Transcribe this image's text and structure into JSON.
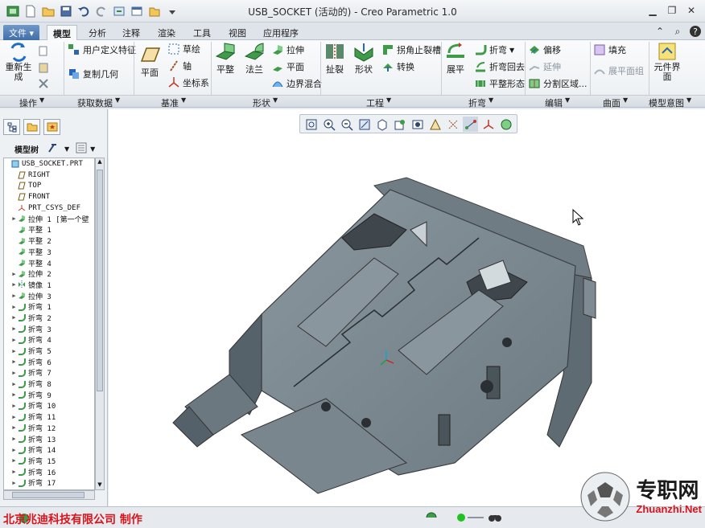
{
  "window": {
    "title": "USB_SOCKET (活动的) - Creo Parametric 1.0"
  },
  "tabs": [
    {
      "label": "文件"
    },
    {
      "label": "模型"
    },
    {
      "label": "分析"
    },
    {
      "label": "注释"
    },
    {
      "label": "渲染"
    },
    {
      "label": "工具"
    },
    {
      "label": "视图"
    },
    {
      "label": "应用程序"
    }
  ],
  "ribbon": {
    "regen": "重新生成",
    "user_feature": "用户定义特征",
    "copy_geom": "复制几何",
    "plane": "平面",
    "sketch": "草绘",
    "axis": "轴",
    "csys": "坐标系",
    "flat": "平整",
    "flange": "法兰",
    "extrude": "拉伸",
    "flat2": "平面",
    "blend": "边界混合",
    "rip": "扯裂",
    "shape": "形状",
    "corner_relief": "拐角止裂槽",
    "convert": "转换",
    "unbend": "展平",
    "bend": "折弯",
    "bend_back": "折弯回去",
    "flat_pattern": "平整形态",
    "offset": "偏移",
    "extend": "延伸",
    "split_area": "分割区域...",
    "fill": "填充",
    "unbend_group": "展平面组",
    "comp_interface": "元件界面"
  },
  "groups": [
    "操作",
    "获取数据",
    "基准",
    "形状",
    "工程",
    "折弯",
    "编辑",
    "曲面",
    "模型意图"
  ],
  "panel": {
    "tree_label": "模型树"
  },
  "tree": [
    {
      "label": "USB_SOCKET.PRT",
      "icon": "part",
      "expand": false,
      "indent": 0
    },
    {
      "label": "RIGHT",
      "icon": "datum-plane",
      "expand": false,
      "indent": 1
    },
    {
      "label": "TOP",
      "icon": "datum-plane",
      "expand": false,
      "indent": 1
    },
    {
      "label": "FRONT",
      "icon": "datum-plane",
      "expand": false,
      "indent": 1
    },
    {
      "label": "PRT_CSYS_DEF",
      "icon": "csys",
      "expand": false,
      "indent": 1
    },
    {
      "label": "拉伸 1 [第一个壁",
      "icon": "wall",
      "expand": true,
      "indent": 1
    },
    {
      "label": "平整 1",
      "icon": "wall",
      "expand": false,
      "indent": 1
    },
    {
      "label": "平整 2",
      "icon": "wall",
      "expand": false,
      "indent": 1
    },
    {
      "label": "平整 3",
      "icon": "wall",
      "expand": false,
      "indent": 1
    },
    {
      "label": "平整 4",
      "icon": "wall",
      "expand": false,
      "indent": 1
    },
    {
      "label": "拉伸 2",
      "icon": "cut",
      "expand": true,
      "indent": 1
    },
    {
      "label": "镜像 1",
      "icon": "mirror",
      "expand": true,
      "indent": 1
    },
    {
      "label": "拉伸 3",
      "icon": "cut",
      "expand": true,
      "indent": 1
    },
    {
      "label": "折弯 1",
      "icon": "bend",
      "expand": true,
      "indent": 1
    },
    {
      "label": "折弯 2",
      "icon": "bend",
      "expand": true,
      "indent": 1
    },
    {
      "label": "折弯 3",
      "icon": "bend",
      "expand": true,
      "indent": 1
    },
    {
      "label": "折弯 4",
      "icon": "bend",
      "expand": true,
      "indent": 1
    },
    {
      "label": "折弯 5",
      "icon": "bend",
      "expand": true,
      "indent": 1
    },
    {
      "label": "折弯 6",
      "icon": "bend",
      "expand": true,
      "indent": 1
    },
    {
      "label": "折弯 7",
      "icon": "bend",
      "expand": true,
      "indent": 1
    },
    {
      "label": "折弯 8",
      "icon": "bend",
      "expand": true,
      "indent": 1
    },
    {
      "label": "折弯 9",
      "icon": "bend",
      "expand": true,
      "indent": 1
    },
    {
      "label": "折弯 10",
      "icon": "bend",
      "expand": true,
      "indent": 1
    },
    {
      "label": "折弯 11",
      "icon": "bend",
      "expand": true,
      "indent": 1
    },
    {
      "label": "折弯 12",
      "icon": "bend",
      "expand": true,
      "indent": 1
    },
    {
      "label": "折弯 13",
      "icon": "bend",
      "expand": true,
      "indent": 1
    },
    {
      "label": "折弯 14",
      "icon": "bend",
      "expand": true,
      "indent": 1
    },
    {
      "label": "折弯 15",
      "icon": "bend",
      "expand": true,
      "indent": 1
    },
    {
      "label": "折弯 16",
      "icon": "bend",
      "expand": true,
      "indent": 1
    },
    {
      "label": "折弯 17",
      "icon": "bend",
      "expand": true,
      "indent": 1
    }
  ],
  "status": {
    "company": "北京兆迪科技有限公司   制作"
  },
  "watermark": {
    "cn": "专职网",
    "en": "Zhuanzhi.Net"
  },
  "colors": {
    "model": "#7e8b92",
    "accent": "#3f6ea8",
    "brand_red": "#d8141c"
  }
}
